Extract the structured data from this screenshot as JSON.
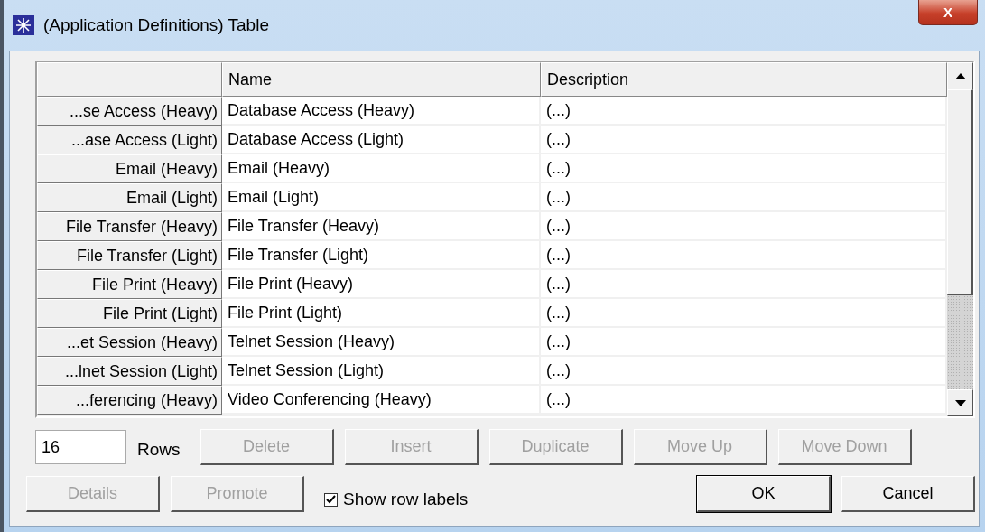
{
  "window": {
    "title": "(Application Definitions) Table",
    "close": "X"
  },
  "table": {
    "columns": [
      "Name",
      "Description"
    ],
    "rows": [
      {
        "label": "...se Access (Heavy)",
        "name": "Database Access (Heavy)",
        "description": "(...)"
      },
      {
        "label": "...ase Access (Light)",
        "name": "Database Access (Light)",
        "description": "(...)"
      },
      {
        "label": "Email (Heavy)",
        "name": "Email (Heavy)",
        "description": "(...)"
      },
      {
        "label": "Email (Light)",
        "name": "Email (Light)",
        "description": "(...)"
      },
      {
        "label": "File Transfer (Heavy)",
        "name": "File Transfer (Heavy)",
        "description": "(...)"
      },
      {
        "label": "File Transfer (Light)",
        "name": "File Transfer (Light)",
        "description": "(...)"
      },
      {
        "label": "File Print (Heavy)",
        "name": "File Print (Heavy)",
        "description": "(...)"
      },
      {
        "label": "File Print (Light)",
        "name": "File Print (Light)",
        "description": "(...)"
      },
      {
        "label": "...et Session (Heavy)",
        "name": "Telnet Session (Heavy)",
        "description": "(...)"
      },
      {
        "label": "...lnet Session (Light)",
        "name": "Telnet Session (Light)",
        "description": "(...)"
      },
      {
        "label": "...ferencing (Heavy)",
        "name": "Video Conferencing (Heavy)",
        "description": "(...)"
      }
    ]
  },
  "rows_field": {
    "value": "16",
    "label": "Rows"
  },
  "edit_buttons": [
    {
      "label": "Delete",
      "disabled": true
    },
    {
      "label": "Insert",
      "disabled": true
    },
    {
      "label": "Duplicate",
      "disabled": true
    },
    {
      "label": "Move Up",
      "disabled": true
    },
    {
      "label": "Move Down",
      "disabled": true
    }
  ],
  "extra_buttons": [
    {
      "label": "Details",
      "disabled": true
    },
    {
      "label": "Promote",
      "disabled": true
    }
  ],
  "show_row_labels": {
    "label": "Show row labels",
    "checked": true
  },
  "dialog_buttons": [
    {
      "label": "OK",
      "disabled": false
    },
    {
      "label": "Cancel",
      "disabled": false
    }
  ]
}
